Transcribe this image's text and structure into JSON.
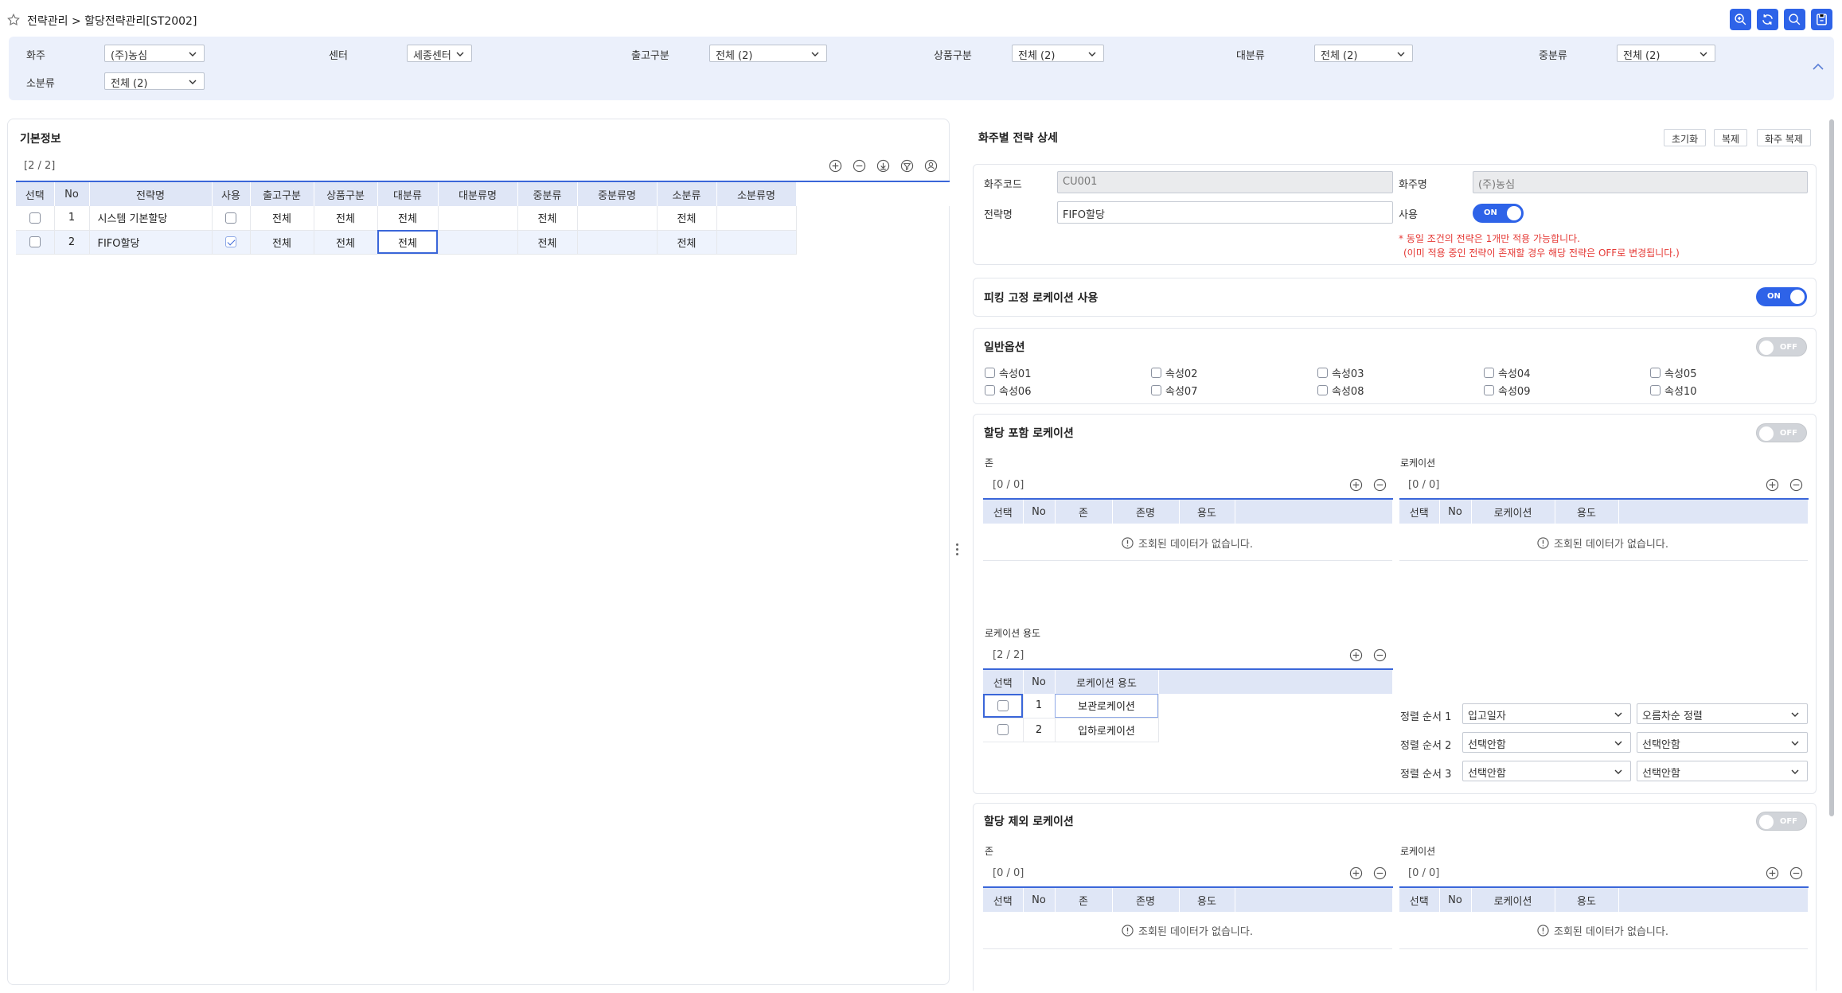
{
  "header": {
    "breadcrumb": "전략관리 > 할당전략관리[ST2002]"
  },
  "filters": [
    {
      "label": "화주",
      "value": "(주)농심"
    },
    {
      "label": "센터",
      "value": "세종센터"
    },
    {
      "label": "출고구분",
      "value": "전체 (2)"
    },
    {
      "label": "상품구분",
      "value": "전체 (2)"
    },
    {
      "label": "대분류",
      "value": "전체 (2)"
    },
    {
      "label": "중분류",
      "value": "전체 (2)"
    },
    {
      "label": "소분류",
      "value": "전체 (2)"
    }
  ],
  "left": {
    "title": "기본정보",
    "count": "[2 / 2]",
    "columns": [
      "선택",
      "No",
      "전략명",
      "사용",
      "출고구분",
      "상품구분",
      "대분류",
      "대분류명",
      "중분류",
      "중분류명",
      "소분류",
      "소분류명"
    ],
    "rows": [
      {
        "no": "1",
        "name": "시스템 기본할당",
        "use": false,
        "out": "전체",
        "prod": "전체",
        "big": "전체",
        "bigName": "",
        "mid": "전체",
        "midName": "",
        "small": "전체",
        "smallName": ""
      },
      {
        "no": "2",
        "name": "FIFO할당",
        "use": true,
        "out": "전체",
        "prod": "전체",
        "big": "전체",
        "bigName": "",
        "mid": "전체",
        "midName": "",
        "small": "전체",
        "smallName": ""
      }
    ]
  },
  "detail": {
    "title": "화주별 전략 상세",
    "buttons": {
      "reset": "초기화",
      "copy": "복제",
      "copyOwner": "화주 복제"
    },
    "ownerCodeLabel": "화주코드",
    "ownerCode": "CU001",
    "ownerNameLabel": "화주명",
    "ownerName": "(주)농심",
    "strategyLabel": "전략명",
    "strategy": "FIFO할당",
    "useLabel": "사용",
    "useToggle": "ON",
    "note1": "* 동일 조건의 전략은 1개만 적용 가능합니다.",
    "note2": "(이미 적용 중인 전략이 존재할 경우 해당 전략은 OFF로 변경됩니다.)"
  },
  "picking": {
    "title": "피킹 고정 로케이션 사용",
    "toggle": "ON"
  },
  "general": {
    "title": "일반옵션",
    "toggle": "OFF",
    "attrs": [
      "속성01",
      "속성02",
      "속성03",
      "속성04",
      "속성05",
      "속성06",
      "속성07",
      "속성08",
      "속성09",
      "속성10"
    ]
  },
  "include": {
    "title": "할당 포함 로케이션",
    "toggle": "OFF",
    "zoneLabel": "존",
    "zoneCount": "[0 / 0]",
    "zoneCols": [
      "선택",
      "No",
      "존",
      "존명",
      "용도"
    ],
    "locLabel": "로케이션",
    "locCount": "[0 / 0]",
    "locCols": [
      "선택",
      "No",
      "로케이션",
      "용도"
    ],
    "empty": "조회된 데이터가 없습니다.",
    "usageLabel": "로케이션 용도",
    "usageCount": "[2 / 2]",
    "usageCols": [
      "선택",
      "No",
      "로케이션 용도"
    ],
    "usageRows": [
      {
        "no": "1",
        "name": "보관로케이션"
      },
      {
        "no": "2",
        "name": "입하로케이션"
      }
    ],
    "sorts": [
      {
        "label": "정렬 순서 1",
        "field": "입고일자",
        "order": "오름차순 정렬"
      },
      {
        "label": "정렬 순서 2",
        "field": "선택안함",
        "order": "선택안함"
      },
      {
        "label": "정렬 순서 3",
        "field": "선택안함",
        "order": "선택안함"
      }
    ]
  },
  "exclude": {
    "title": "할당 제외 로케이션",
    "toggle": "OFF",
    "zoneLabel": "존",
    "zoneCount": "[0 / 0]",
    "zoneCols": [
      "선택",
      "No",
      "존",
      "존명",
      "용도"
    ],
    "locLabel": "로케이션",
    "locCount": "[0 / 0]",
    "locCols": [
      "선택",
      "No",
      "로케이션",
      "용도"
    ],
    "empty": "조회된 데이터가 없습니다."
  }
}
